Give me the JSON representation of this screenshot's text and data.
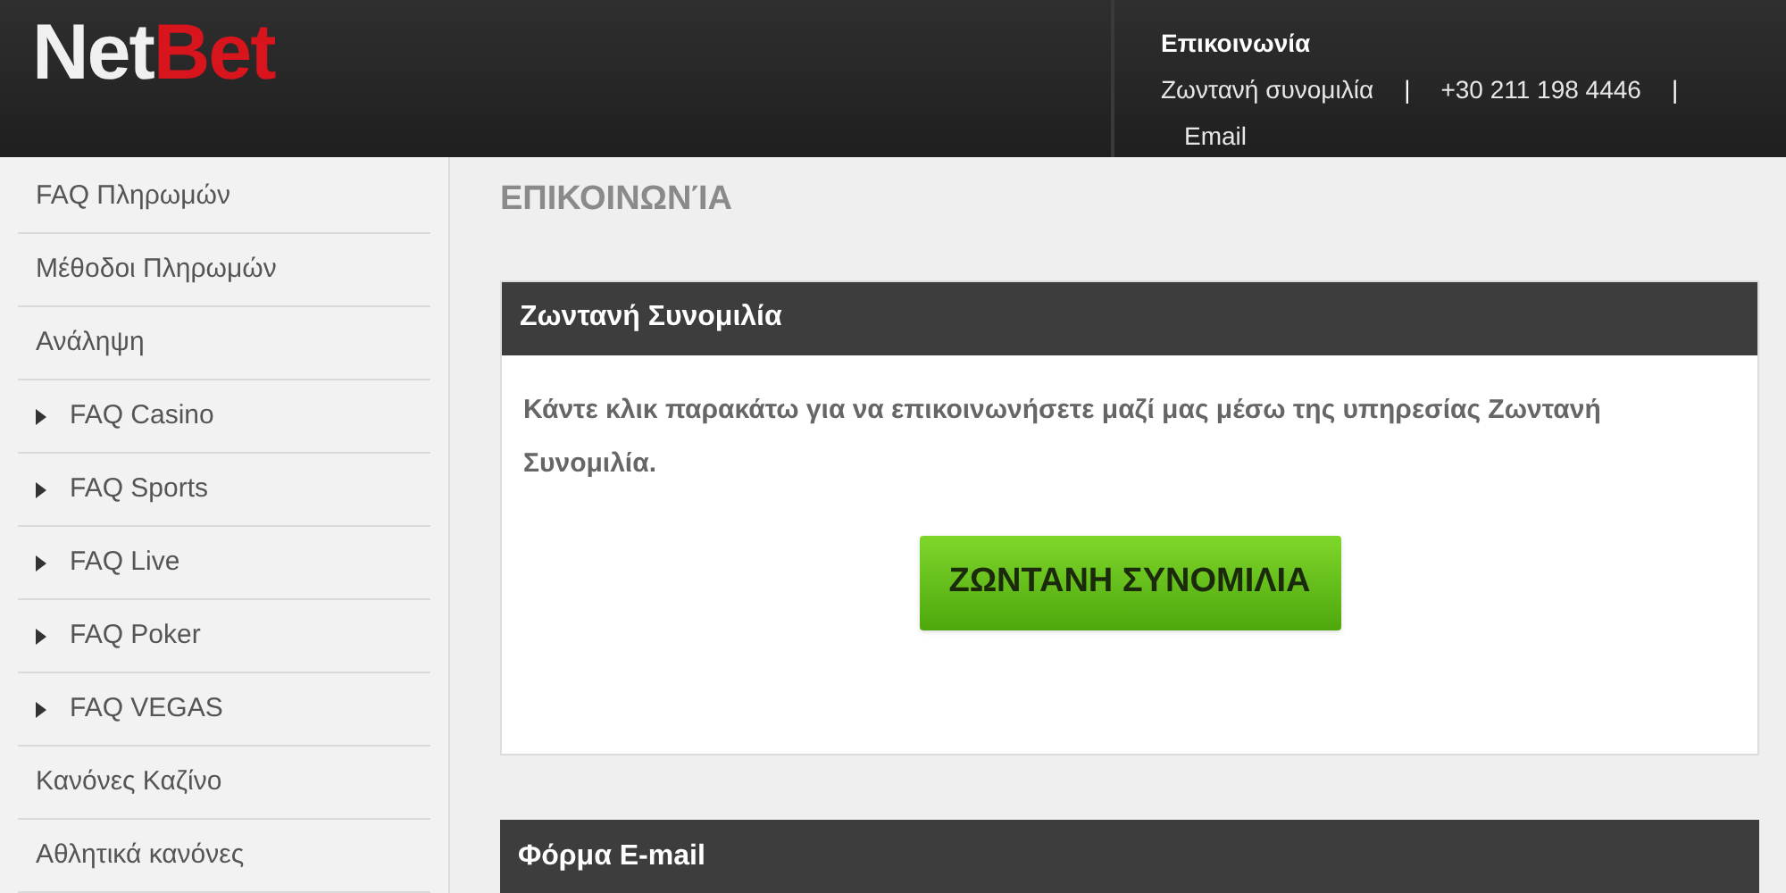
{
  "logo": {
    "parts": [
      {
        "text": "Net",
        "color": "#f0f0f0"
      },
      {
        "text": "Bet",
        "color": "#d8141c"
      }
    ]
  },
  "contact": {
    "title": "Επικοινωνία",
    "separator": "|",
    "links": [
      "Ζωντανή συνομιλία",
      "+30 211 198 4446",
      "Email"
    ]
  },
  "sidebar": {
    "items": [
      {
        "label": "FAQ Πληρωμών",
        "kind": "link"
      },
      {
        "label": "Μέθοδοι Πληρωμών",
        "kind": "link"
      },
      {
        "label": "Ανάληψη",
        "kind": "link"
      },
      {
        "label": "FAQ Casino",
        "kind": "group"
      },
      {
        "label": "FAQ Sports",
        "kind": "group"
      },
      {
        "label": "FAQ Live",
        "kind": "group"
      },
      {
        "label": "FAQ Poker",
        "kind": "group"
      },
      {
        "label": "FAQ VEGAS",
        "kind": "group"
      },
      {
        "label": "Κανόνες Καζίνο",
        "kind": "link"
      },
      {
        "label": "Αθλητικά κανόνες",
        "kind": "link"
      }
    ]
  },
  "page_title": "ΕΠΙΚΟΙΝΩΝΊΑ",
  "live_chat": {
    "title": "Ζωντανή Συνομιλία",
    "text": "Κάντε κλικ παρακάτω για να επικοινωνήσετε μαζί μας μέσω της υπηρεσίας Ζωντανή Συνομιλία.",
    "button": "ΖΩΝΤΑΝΗ ΣΥΝΟΜΙΛΙΑ"
  },
  "email_form": {
    "title": "Φόρμα E-mail"
  }
}
